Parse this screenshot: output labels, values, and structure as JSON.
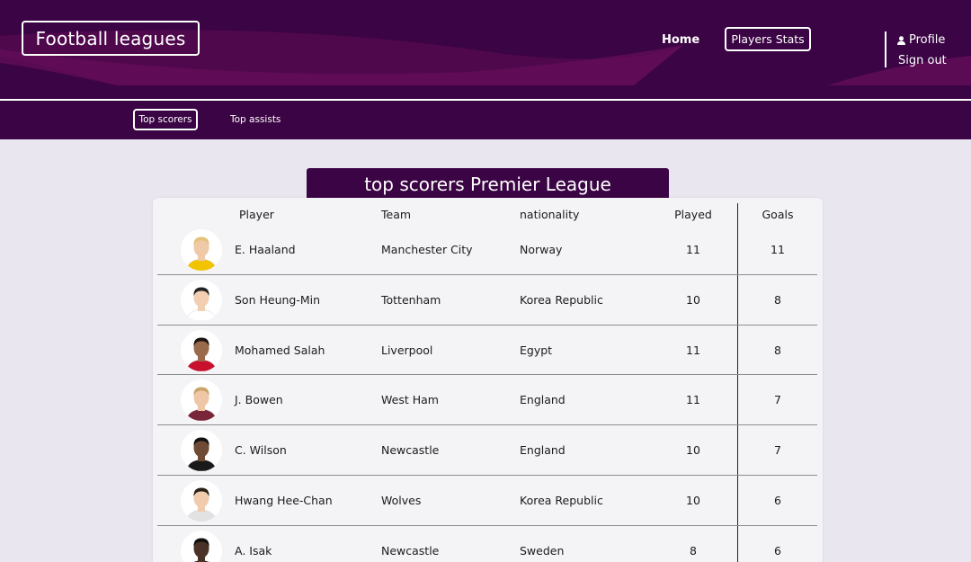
{
  "header": {
    "logo": "Football leagues",
    "nav": {
      "home": "Home",
      "players_stats": "Players Stats",
      "profile": "Profile",
      "sign_out": "Sign out"
    },
    "brand_color": "#3b0444"
  },
  "subnav": {
    "tabs": [
      "Top scorers",
      "Top assists"
    ],
    "active": "Top scorers"
  },
  "table": {
    "title": "top scorers Premier League",
    "headers": {
      "player": "Player",
      "team": "Team",
      "nationality": "nationality",
      "played": "Played",
      "goals": "Goals"
    },
    "rows": [
      {
        "name": "E. Haaland",
        "team": "Manchester City",
        "nationality": "Norway",
        "played": "11",
        "goals": "11",
        "kit": "#f2c400",
        "skin": "#f0c9a8",
        "hair": "#e3c27a"
      },
      {
        "name": "Son Heung-Min",
        "team": "Tottenham",
        "nationality": "Korea Republic",
        "played": "10",
        "goals": "8",
        "kit": "#ffffff",
        "skin": "#f1cfb0",
        "hair": "#222222"
      },
      {
        "name": "Mohamed Salah",
        "team": "Liverpool",
        "nationality": "Egypt",
        "played": "11",
        "goals": "8",
        "kit": "#c8102e",
        "skin": "#9a6b4b",
        "hair": "#1e1410"
      },
      {
        "name": "J. Bowen",
        "team": "West Ham",
        "nationality": "England",
        "played": "11",
        "goals": "7",
        "kit": "#7a263a",
        "skin": "#f0c7a6",
        "hair": "#c9a36a"
      },
      {
        "name": "C. Wilson",
        "team": "Newcastle",
        "nationality": "England",
        "played": "10",
        "goals": "7",
        "kit": "#1a1a1a",
        "skin": "#6f4a34",
        "hair": "#111111"
      },
      {
        "name": "Hwang Hee-Chan",
        "team": "Wolves",
        "nationality": "Korea Republic",
        "played": "10",
        "goals": "6",
        "kit": "#e2e2e2",
        "skin": "#f0ccad",
        "hair": "#2a2018"
      },
      {
        "name": "A. Isak",
        "team": "Newcastle",
        "nationality": "Sweden",
        "played": "8",
        "goals": "6",
        "kit": "#1a1a1a",
        "skin": "#4a3326",
        "hair": "#0f0f0f"
      }
    ]
  }
}
